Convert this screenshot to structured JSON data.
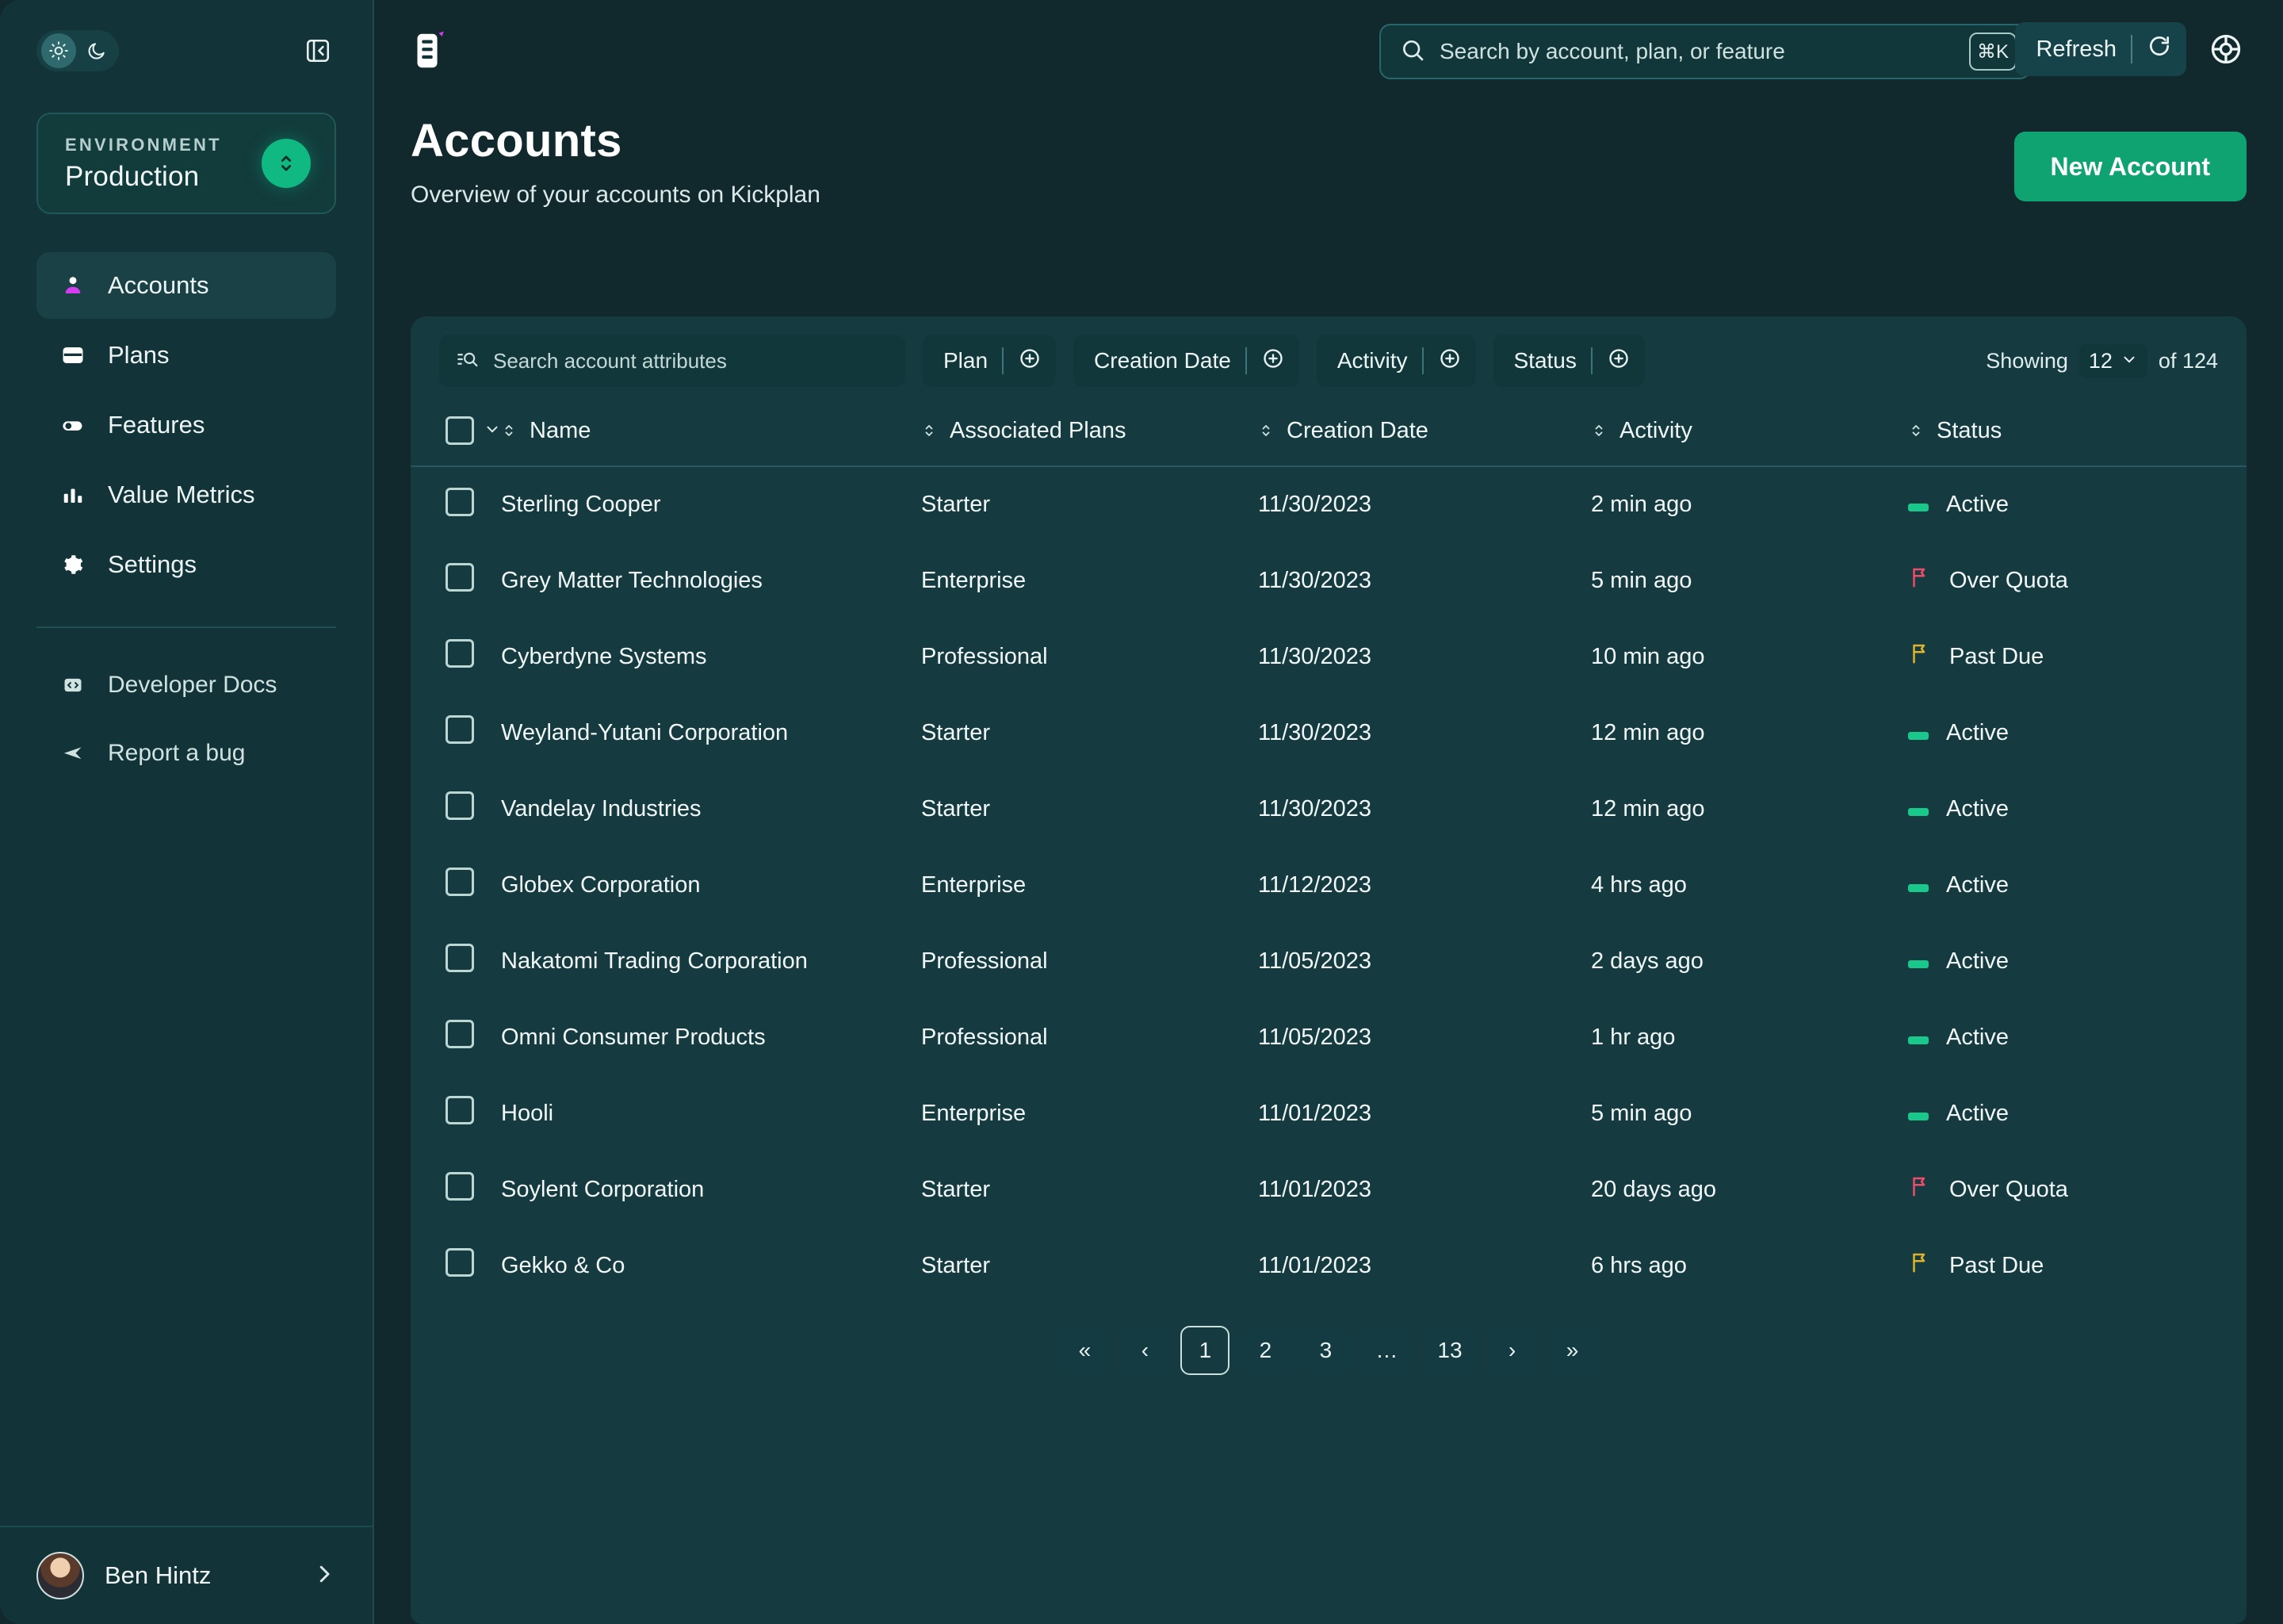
{
  "sidebar": {
    "theme": {
      "light_icon": "sun-icon",
      "dark_icon": "moon-icon",
      "collapse_icon": "panel-collapse-icon"
    },
    "environment": {
      "label": "ENVIRONMENT",
      "value": "Production",
      "switch_icon": "selector-icon"
    },
    "nav": [
      {
        "label": "Accounts",
        "icon": "person-icon",
        "active": true
      },
      {
        "label": "Plans",
        "icon": "card-icon",
        "active": false
      },
      {
        "label": "Features",
        "icon": "toggle-icon",
        "active": false
      },
      {
        "label": "Value Metrics",
        "icon": "bar-chart-icon",
        "active": false
      },
      {
        "label": "Settings",
        "icon": "gear-icon",
        "active": false
      }
    ],
    "nav_secondary": [
      {
        "label": "Developer Docs",
        "icon": "code-icon"
      },
      {
        "label": "Report a bug",
        "icon": "send-icon"
      }
    ],
    "user": {
      "name": "Ben Hintz",
      "chevron_icon": "chevron-right-icon",
      "avatar_icon": "avatar"
    }
  },
  "topbar": {
    "logo_icon": "kickplan-logo-icon",
    "search": {
      "placeholder": "Search by account, plan, or feature",
      "icon": "search-icon",
      "shortcut": "⌘K"
    },
    "refresh": {
      "label": "Refresh",
      "icon": "refresh-icon"
    },
    "help_icon": "lifebuoy-icon"
  },
  "page": {
    "title": "Accounts",
    "subtitle": "Overview of your accounts on Kickplan",
    "primary_action": "New Account"
  },
  "toolbar": {
    "attribute_search": {
      "placeholder": "Search account attributes",
      "icon": "filter-search-icon"
    },
    "filters": [
      {
        "label": "Plan",
        "icon": "plus-circle-icon"
      },
      {
        "label": "Creation Date",
        "icon": "plus-circle-icon"
      },
      {
        "label": "Activity",
        "icon": "plus-circle-icon"
      },
      {
        "label": "Status",
        "icon": "plus-circle-icon"
      }
    ],
    "showing_prefix": "Showing",
    "showing_count": "12",
    "showing_caret": "chevron-down-icon",
    "showing_suffix": "of 124"
  },
  "table": {
    "columns": [
      "Name",
      "Associated Plans",
      "Creation Date",
      "Activity",
      "Status"
    ],
    "rows": [
      {
        "name": "Sterling Cooper",
        "plan": "Starter",
        "created": "11/30/2023",
        "activity": "2 min ago",
        "status": "Active",
        "status_kind": "active"
      },
      {
        "name": "Grey Matter Technologies",
        "plan": "Enterprise",
        "created": "11/30/2023",
        "activity": "5 min ago",
        "status": "Over Quota",
        "status_kind": "over-quota"
      },
      {
        "name": "Cyberdyne Systems",
        "plan": "Professional",
        "created": "11/30/2023",
        "activity": "10 min ago",
        "status": "Past Due",
        "status_kind": "past-due"
      },
      {
        "name": "Weyland-Yutani Corporation",
        "plan": "Starter",
        "created": "11/30/2023",
        "activity": "12 min ago",
        "status": "Active",
        "status_kind": "active"
      },
      {
        "name": "Vandelay Industries",
        "plan": "Starter",
        "created": "11/30/2023",
        "activity": "12 min ago",
        "status": "Active",
        "status_kind": "active"
      },
      {
        "name": "Globex Corporation",
        "plan": "Enterprise",
        "created": "11/12/2023",
        "activity": "4 hrs ago",
        "status": "Active",
        "status_kind": "active"
      },
      {
        "name": "Nakatomi Trading Corporation",
        "plan": "Professional",
        "created": "11/05/2023",
        "activity": "2 days ago",
        "status": "Active",
        "status_kind": "active"
      },
      {
        "name": "Omni Consumer Products",
        "plan": "Professional",
        "created": "11/05/2023",
        "activity": "1 hr ago",
        "status": "Active",
        "status_kind": "active"
      },
      {
        "name": "Hooli",
        "plan": "Enterprise",
        "created": "11/01/2023",
        "activity": "5 min ago",
        "status": "Active",
        "status_kind": "active"
      },
      {
        "name": "Soylent Corporation",
        "plan": "Starter",
        "created": "11/01/2023",
        "activity": "20 days ago",
        "status": "Over Quota",
        "status_kind": "over-quota"
      },
      {
        "name": "Gekko & Co",
        "plan": "Starter",
        "created": "11/01/2023",
        "activity": "6 hrs ago",
        "status": "Past Due",
        "status_kind": "past-due"
      }
    ]
  },
  "pagination": {
    "first": "«",
    "prev": "‹",
    "next": "›",
    "last": "»",
    "pages": [
      "1",
      "2",
      "3",
      "…",
      "13"
    ],
    "current": "1"
  },
  "colors": {
    "accent_green": "#10a372",
    "status_active": "#19c98b",
    "status_over_quota": "#ef4b6a",
    "status_past_due": "#e0b32a",
    "brand_magenta": "#d43cf0",
    "sidebar_bg": "#123338",
    "main_bg": "#11292d",
    "panel_bg": "#153a40"
  }
}
